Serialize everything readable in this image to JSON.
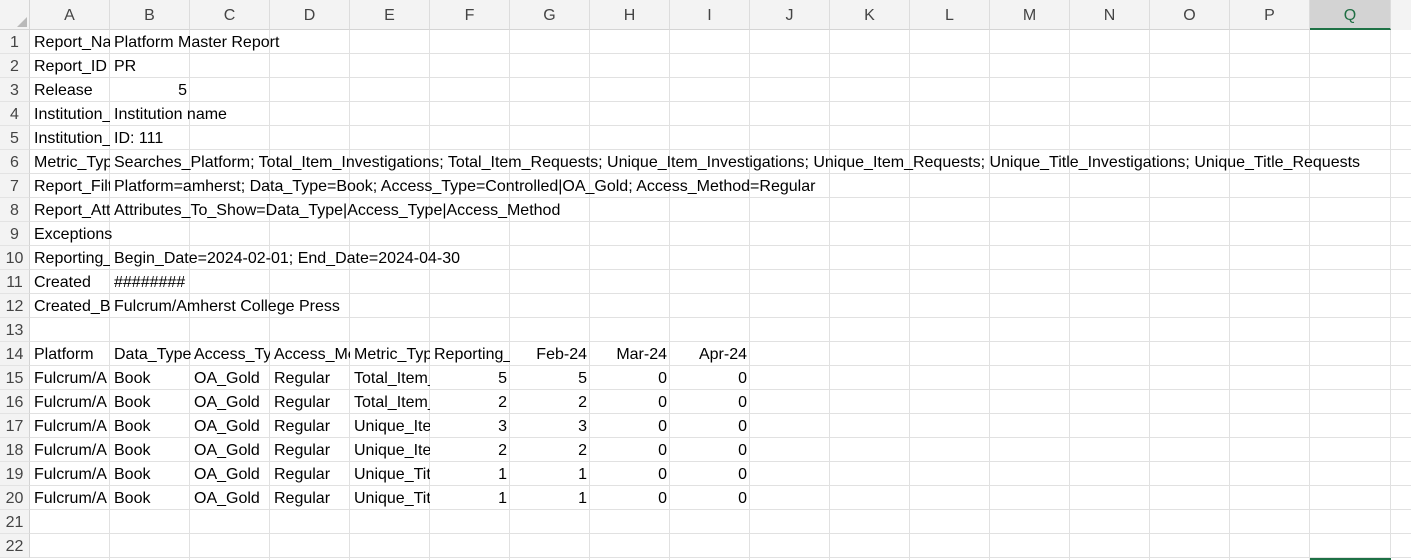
{
  "columns": [
    "A",
    "B",
    "C",
    "D",
    "E",
    "F",
    "G",
    "H",
    "I",
    "J",
    "K",
    "L",
    "M",
    "N",
    "O",
    "P",
    "Q"
  ],
  "selected_column": "Q",
  "rows": [
    {
      "num": "1",
      "cells": [
        {
          "col": "A",
          "text": "Report_Na",
          "clip": true
        },
        {
          "col": "B",
          "text": "Platform Master Report"
        }
      ]
    },
    {
      "num": "2",
      "cells": [
        {
          "col": "A",
          "text": "Report_ID"
        },
        {
          "col": "B",
          "text": "PR"
        }
      ]
    },
    {
      "num": "3",
      "cells": [
        {
          "col": "A",
          "text": "Release"
        },
        {
          "col": "B",
          "text": "5",
          "num": true
        }
      ]
    },
    {
      "num": "4",
      "cells": [
        {
          "col": "A",
          "text": "Institution_",
          "clip": true
        },
        {
          "col": "B",
          "text": "Institution name"
        }
      ]
    },
    {
      "num": "5",
      "cells": [
        {
          "col": "A",
          "text": "Institution_",
          "clip": true
        },
        {
          "col": "B",
          "text": "ID: 111"
        }
      ]
    },
    {
      "num": "6",
      "cells": [
        {
          "col": "A",
          "text": "Metric_Typ",
          "clip": true
        },
        {
          "col": "B",
          "text": "Searches_Platform; Total_Item_Investigations; Total_Item_Requests; Unique_Item_Investigations; Unique_Item_Requests; Unique_Title_Investigations; Unique_Title_Requests"
        }
      ]
    },
    {
      "num": "7",
      "cells": [
        {
          "col": "A",
          "text": "Report_Filt",
          "clip": true
        },
        {
          "col": "B",
          "text": "Platform=amherst; Data_Type=Book; Access_Type=Controlled|OA_Gold; Access_Method=Regular"
        }
      ]
    },
    {
      "num": "8",
      "cells": [
        {
          "col": "A",
          "text": "Report_Att",
          "clip": true
        },
        {
          "col": "B",
          "text": "Attributes_To_Show=Data_Type|Access_Type|Access_Method"
        }
      ]
    },
    {
      "num": "9",
      "cells": [
        {
          "col": "A",
          "text": "Exceptions"
        }
      ]
    },
    {
      "num": "10",
      "cells": [
        {
          "col": "A",
          "text": "Reporting_",
          "clip": true
        },
        {
          "col": "B",
          "text": "Begin_Date=2024-02-01; End_Date=2024-04-30"
        }
      ]
    },
    {
      "num": "11",
      "cells": [
        {
          "col": "A",
          "text": "Created"
        },
        {
          "col": "B",
          "text": "########"
        }
      ]
    },
    {
      "num": "12",
      "cells": [
        {
          "col": "A",
          "text": "Created_B",
          "clip": true
        },
        {
          "col": "B",
          "text": "Fulcrum/Amherst College Press"
        }
      ]
    },
    {
      "num": "13",
      "cells": []
    },
    {
      "num": "14",
      "cells": [
        {
          "col": "A",
          "text": "Platform"
        },
        {
          "col": "B",
          "text": "Data_Type"
        },
        {
          "col": "C",
          "text": "Access_Ty",
          "clip": true
        },
        {
          "col": "D",
          "text": "Access_Me",
          "clip": true
        },
        {
          "col": "E",
          "text": "Metric_Typ",
          "clip": true
        },
        {
          "col": "F",
          "text": "Reporting_",
          "clip": true
        },
        {
          "col": "G",
          "text": "Feb-24",
          "num": true
        },
        {
          "col": "H",
          "text": "Mar-24",
          "num": true
        },
        {
          "col": "I",
          "text": "Apr-24",
          "num": true
        }
      ]
    },
    {
      "num": "15",
      "cells": [
        {
          "col": "A",
          "text": "Fulcrum/A",
          "clip": true
        },
        {
          "col": "B",
          "text": "Book"
        },
        {
          "col": "C",
          "text": "OA_Gold"
        },
        {
          "col": "D",
          "text": "Regular"
        },
        {
          "col": "E",
          "text": "Total_Item_",
          "clip": true
        },
        {
          "col": "F",
          "text": "5",
          "num": true
        },
        {
          "col": "G",
          "text": "5",
          "num": true
        },
        {
          "col": "H",
          "text": "0",
          "num": true
        },
        {
          "col": "I",
          "text": "0",
          "num": true
        }
      ]
    },
    {
      "num": "16",
      "cells": [
        {
          "col": "A",
          "text": "Fulcrum/A",
          "clip": true
        },
        {
          "col": "B",
          "text": "Book"
        },
        {
          "col": "C",
          "text": "OA_Gold"
        },
        {
          "col": "D",
          "text": "Regular"
        },
        {
          "col": "E",
          "text": "Total_Item_",
          "clip": true
        },
        {
          "col": "F",
          "text": "2",
          "num": true
        },
        {
          "col": "G",
          "text": "2",
          "num": true
        },
        {
          "col": "H",
          "text": "0",
          "num": true
        },
        {
          "col": "I",
          "text": "0",
          "num": true
        }
      ]
    },
    {
      "num": "17",
      "cells": [
        {
          "col": "A",
          "text": "Fulcrum/A",
          "clip": true
        },
        {
          "col": "B",
          "text": "Book"
        },
        {
          "col": "C",
          "text": "OA_Gold"
        },
        {
          "col": "D",
          "text": "Regular"
        },
        {
          "col": "E",
          "text": "Unique_Ite",
          "clip": true
        },
        {
          "col": "F",
          "text": "3",
          "num": true
        },
        {
          "col": "G",
          "text": "3",
          "num": true
        },
        {
          "col": "H",
          "text": "0",
          "num": true
        },
        {
          "col": "I",
          "text": "0",
          "num": true
        }
      ]
    },
    {
      "num": "18",
      "cells": [
        {
          "col": "A",
          "text": "Fulcrum/A",
          "clip": true
        },
        {
          "col": "B",
          "text": "Book"
        },
        {
          "col": "C",
          "text": "OA_Gold"
        },
        {
          "col": "D",
          "text": "Regular"
        },
        {
          "col": "E",
          "text": "Unique_Ite",
          "clip": true
        },
        {
          "col": "F",
          "text": "2",
          "num": true
        },
        {
          "col": "G",
          "text": "2",
          "num": true
        },
        {
          "col": "H",
          "text": "0",
          "num": true
        },
        {
          "col": "I",
          "text": "0",
          "num": true
        }
      ]
    },
    {
      "num": "19",
      "cells": [
        {
          "col": "A",
          "text": "Fulcrum/A",
          "clip": true
        },
        {
          "col": "B",
          "text": "Book"
        },
        {
          "col": "C",
          "text": "OA_Gold"
        },
        {
          "col": "D",
          "text": "Regular"
        },
        {
          "col": "E",
          "text": "Unique_Tit",
          "clip": true
        },
        {
          "col": "F",
          "text": "1",
          "num": true
        },
        {
          "col": "G",
          "text": "1",
          "num": true
        },
        {
          "col": "H",
          "text": "0",
          "num": true
        },
        {
          "col": "I",
          "text": "0",
          "num": true
        }
      ]
    },
    {
      "num": "20",
      "cells": [
        {
          "col": "A",
          "text": "Fulcrum/A",
          "clip": true
        },
        {
          "col": "B",
          "text": "Book"
        },
        {
          "col": "C",
          "text": "OA_Gold"
        },
        {
          "col": "D",
          "text": "Regular"
        },
        {
          "col": "E",
          "text": "Unique_Tit",
          "clip": true
        },
        {
          "col": "F",
          "text": "1",
          "num": true
        },
        {
          "col": "G",
          "text": "1",
          "num": true
        },
        {
          "col": "H",
          "text": "0",
          "num": true
        },
        {
          "col": "I",
          "text": "0",
          "num": true
        }
      ]
    },
    {
      "num": "21",
      "cells": []
    },
    {
      "num": "22",
      "cells": []
    }
  ]
}
